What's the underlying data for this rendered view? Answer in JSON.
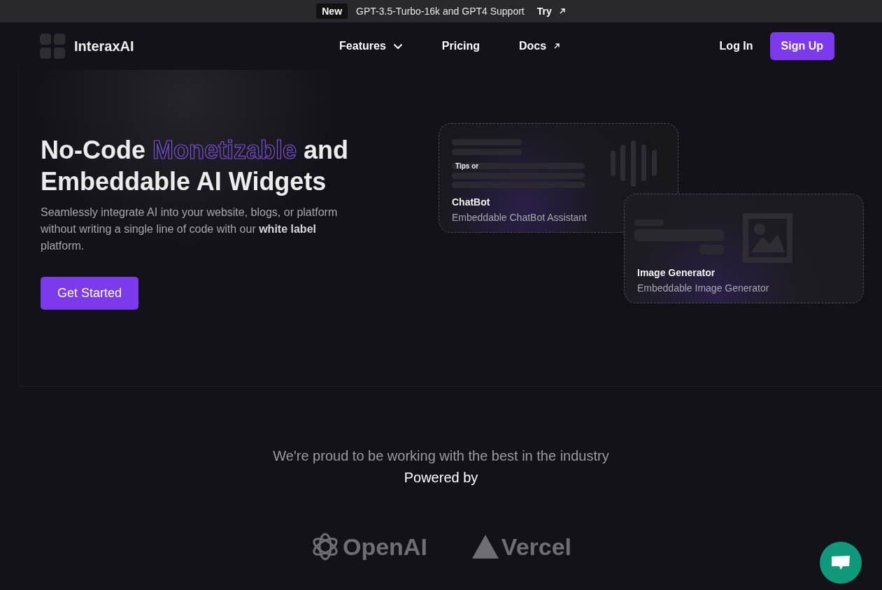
{
  "announcement": {
    "badge": "New",
    "text": "GPT-3.5-Turbo-16k and GPT4 Support",
    "link": "Try"
  },
  "nav": {
    "brand": "InteraxAI",
    "links": [
      {
        "label": "Features",
        "kind": "dropdown"
      },
      {
        "label": "Pricing",
        "kind": "plain"
      },
      {
        "label": "Docs",
        "kind": "external"
      }
    ],
    "login": "Log In",
    "signup": "Sign Up"
  },
  "hero": {
    "title_parts": [
      {
        "text": "No-Code ",
        "kind": "plain"
      },
      {
        "text": "Monetizable",
        "kind": "outline"
      },
      {
        "text": " and Embeddable AI Widgets",
        "kind": "plain"
      }
    ],
    "subtitle": "Seamlessly integrate AI into your website, blogs, or platform without writing a single line of code with our **white label** platform.",
    "cta": "Get Started"
  },
  "widgets": [
    {
      "kind": "chatbot",
      "snippet": "Tips or",
      "title": "ChatBot",
      "description": "Embeddable ChatBot Assistant"
    },
    {
      "kind": "image",
      "title": "Image Generator",
      "description": "Embeddable Image Generator"
    }
  ],
  "partners": {
    "tagline": "We're proud to be working with the best in the industry",
    "heading": "Powered by",
    "logos": [
      {
        "kind": "openai",
        "name": "OpenAI"
      },
      {
        "kind": "vercel",
        "name": "Vercel"
      }
    ]
  }
}
